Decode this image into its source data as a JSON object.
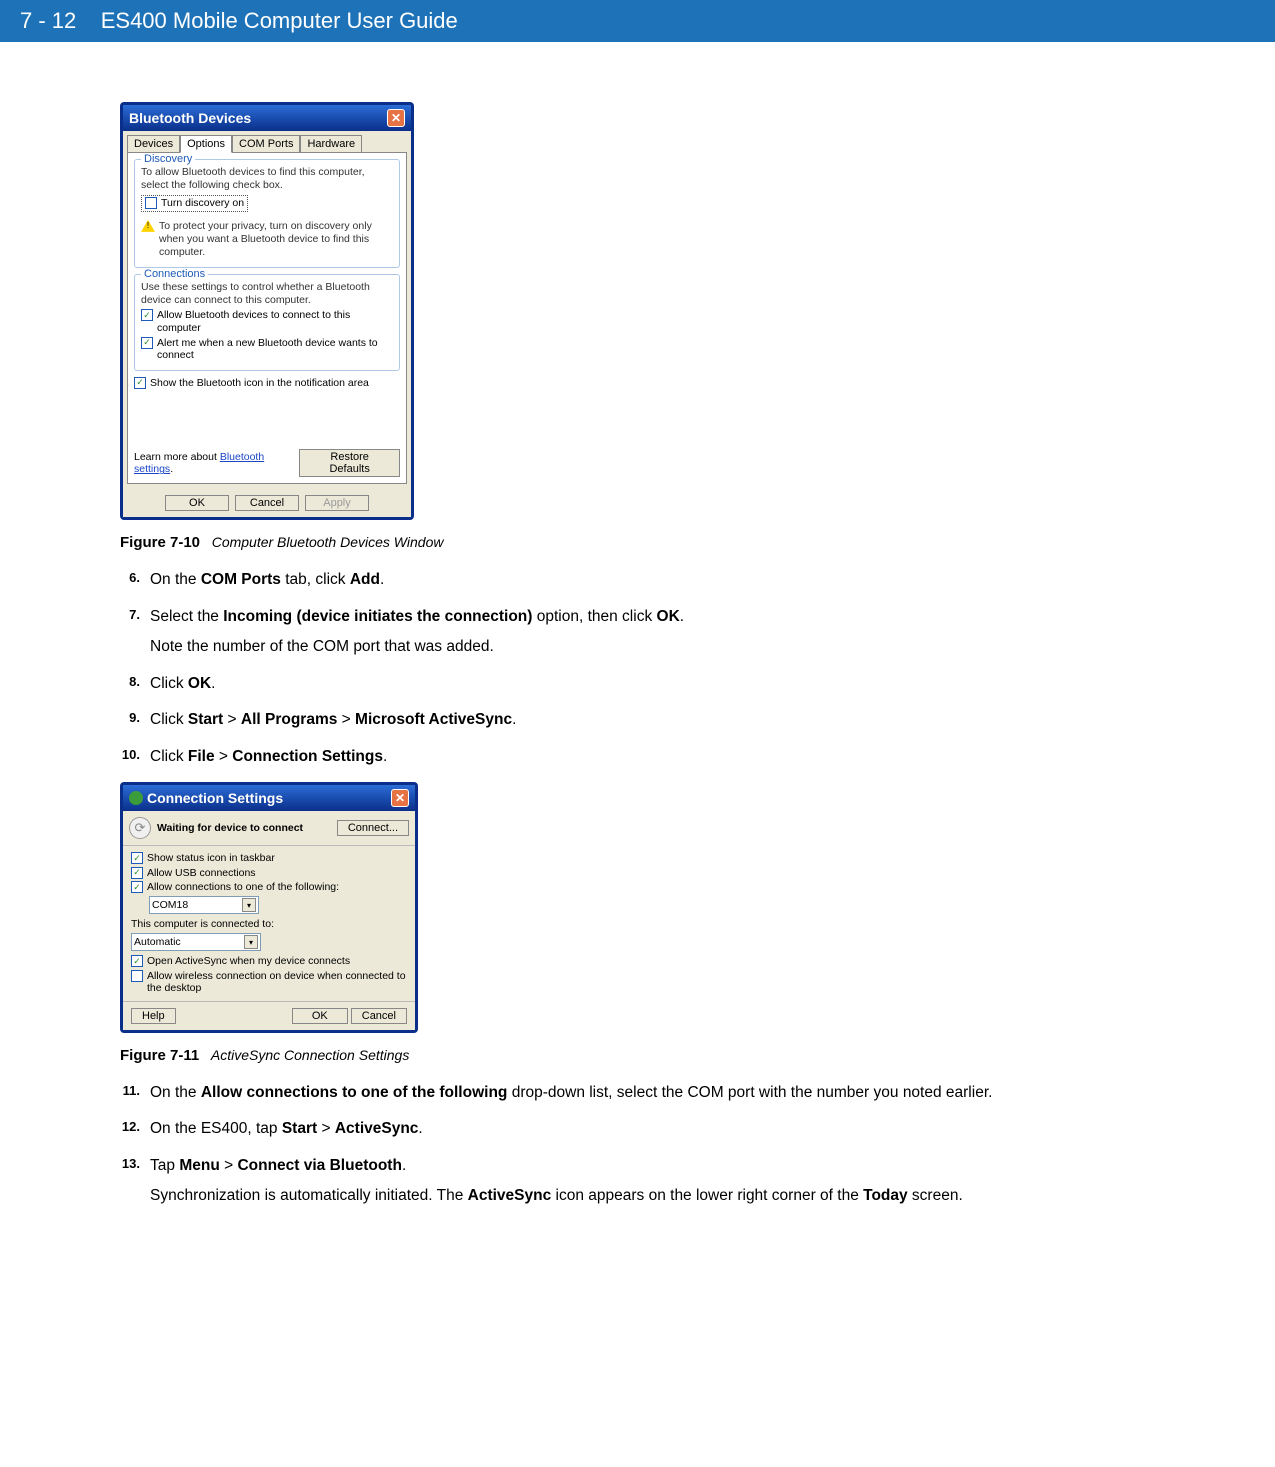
{
  "header": {
    "page_no": "7 - 12",
    "title": "ES400 Mobile Computer User Guide"
  },
  "fig1_window": {
    "title": "Bluetooth Devices",
    "tabs": [
      "Devices",
      "Options",
      "COM Ports",
      "Hardware"
    ],
    "active_tab": "Options",
    "discovery": {
      "label": "Discovery",
      "desc": "To allow Bluetooth devices to find this computer, select the following check box.",
      "checkbox": "Turn discovery on",
      "warn": "To protect your privacy, turn on discovery only when you want a Bluetooth device to find this computer."
    },
    "connections": {
      "label": "Connections",
      "desc": "Use these settings to control whether a Bluetooth device can connect to this computer.",
      "chk1": "Allow Bluetooth devices to connect to this computer",
      "chk2": "Alert me when a new Bluetooth device wants to connect"
    },
    "show_icon": "Show the Bluetooth icon in the notification area",
    "learn_more": "Learn more about",
    "learn_link": "Bluetooth settings",
    "restore": "Restore Defaults",
    "ok": "OK",
    "cancel": "Cancel",
    "apply": "Apply"
  },
  "fig1_caption": {
    "label": "Figure 7-10",
    "text": "Computer Bluetooth Devices Window"
  },
  "steps_a": [
    {
      "n": "6.",
      "parts": [
        "On the ",
        "COM Ports",
        " tab, click ",
        "Add",
        "."
      ]
    },
    {
      "n": "7.",
      "parts": [
        "Select the ",
        "Incoming (device initiates the connection)",
        " option, then click ",
        "OK",
        "."
      ],
      "sub": "Note the number of the COM port that was added."
    },
    {
      "n": "8.",
      "parts": [
        "Click ",
        "OK",
        "."
      ]
    },
    {
      "n": "9.",
      "parts": [
        "Click ",
        "Start",
        " > ",
        "All Programs",
        " > ",
        "Microsoft ActiveSync",
        "."
      ]
    },
    {
      "n": "10.",
      "parts": [
        "Click ",
        "File",
        " > ",
        "Connection Settings",
        "."
      ]
    }
  ],
  "fig2_window": {
    "title": "Connection Settings",
    "status": "Waiting for device to connect",
    "connect_btn": "Connect...",
    "chk_status_icon": "Show status icon in taskbar",
    "chk_usb": "Allow USB connections",
    "chk_conn": "Allow connections to one of the following:",
    "com_value": "COM18",
    "connected_to": "This computer is connected to:",
    "connected_value": "Automatic",
    "chk_open": "Open ActiveSync when my device connects",
    "chk_wireless": "Allow wireless connection on device when connected to the desktop",
    "help": "Help",
    "ok": "OK",
    "cancel": "Cancel"
  },
  "fig2_caption": {
    "label": "Figure 7-11",
    "text": "ActiveSync Connection Settings"
  },
  "steps_b": [
    {
      "n": "11.",
      "parts": [
        "On the ",
        "Allow connections to one of the following",
        " drop-down list, select the COM port with the number you noted earlier."
      ]
    },
    {
      "n": "12.",
      "parts": [
        "On the ES400, tap ",
        "Start",
        " > ",
        "ActiveSync",
        "."
      ]
    },
    {
      "n": "13.",
      "parts": [
        "Tap ",
        "Menu",
        " > ",
        "Connect via Bluetooth",
        "."
      ],
      "sub_parts": [
        "Synchronization is automatically initiated. The ",
        "ActiveSync",
        " icon appears on the lower right corner of the ",
        "Today",
        " screen."
      ]
    }
  ]
}
